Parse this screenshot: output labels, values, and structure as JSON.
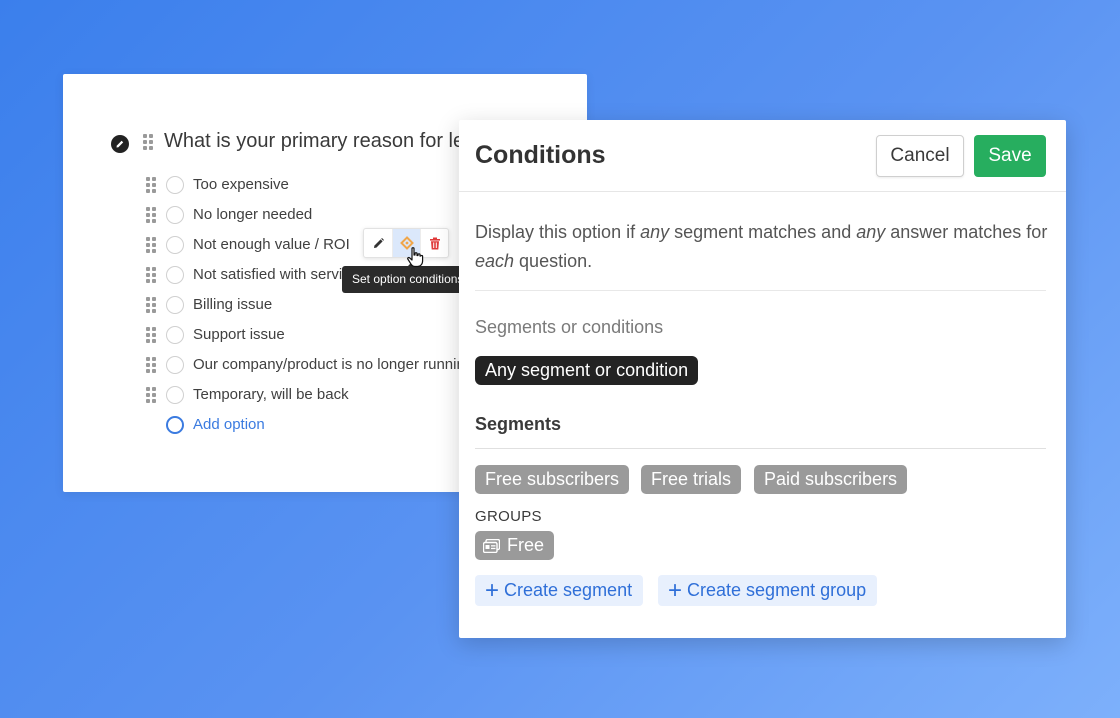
{
  "question": {
    "title": "What is your primary reason for leaving?",
    "options": [
      {
        "label": "Too expensive"
      },
      {
        "label": "No longer needed"
      },
      {
        "label": "Not enough value / ROI"
      },
      {
        "label": "Not satisfied with service"
      },
      {
        "label": "Billing issue"
      },
      {
        "label": "Support issue"
      },
      {
        "label": "Our company/product is no longer running"
      },
      {
        "label": "Temporary, will be back"
      }
    ],
    "add_option_label": "Add option",
    "option_toolbar": {
      "icons": [
        "pencil-icon",
        "conditions-diamond-icon",
        "trash-icon"
      ],
      "tooltip": "Set option conditions"
    }
  },
  "modal": {
    "title": "Conditions",
    "cancel_label": "Cancel",
    "save_label": "Save",
    "description": {
      "p1": "Display this option if ",
      "em1": "any",
      "p2": " segment matches and ",
      "em2": "any",
      "p3": " answer matches for ",
      "em3": "each",
      "p4": " question."
    },
    "segments_or_conditions_label": "Segments or conditions",
    "selected_chip": "Any segment or condition",
    "segments_heading": "Segments",
    "segments": [
      "Free subscribers",
      "Free trials",
      "Paid subscribers"
    ],
    "groups_label": "GROUPS",
    "group_chip": "Free",
    "create_segment_label": "Create segment",
    "create_group_label": "Create segment group"
  },
  "colors": {
    "background_start": "#3b7fec",
    "background_end": "#7db0fb",
    "save_green": "#27ae5f",
    "link_blue": "#2f6fd8",
    "chip_dark": "#232323",
    "chip_gray": "#9a9a9a"
  }
}
